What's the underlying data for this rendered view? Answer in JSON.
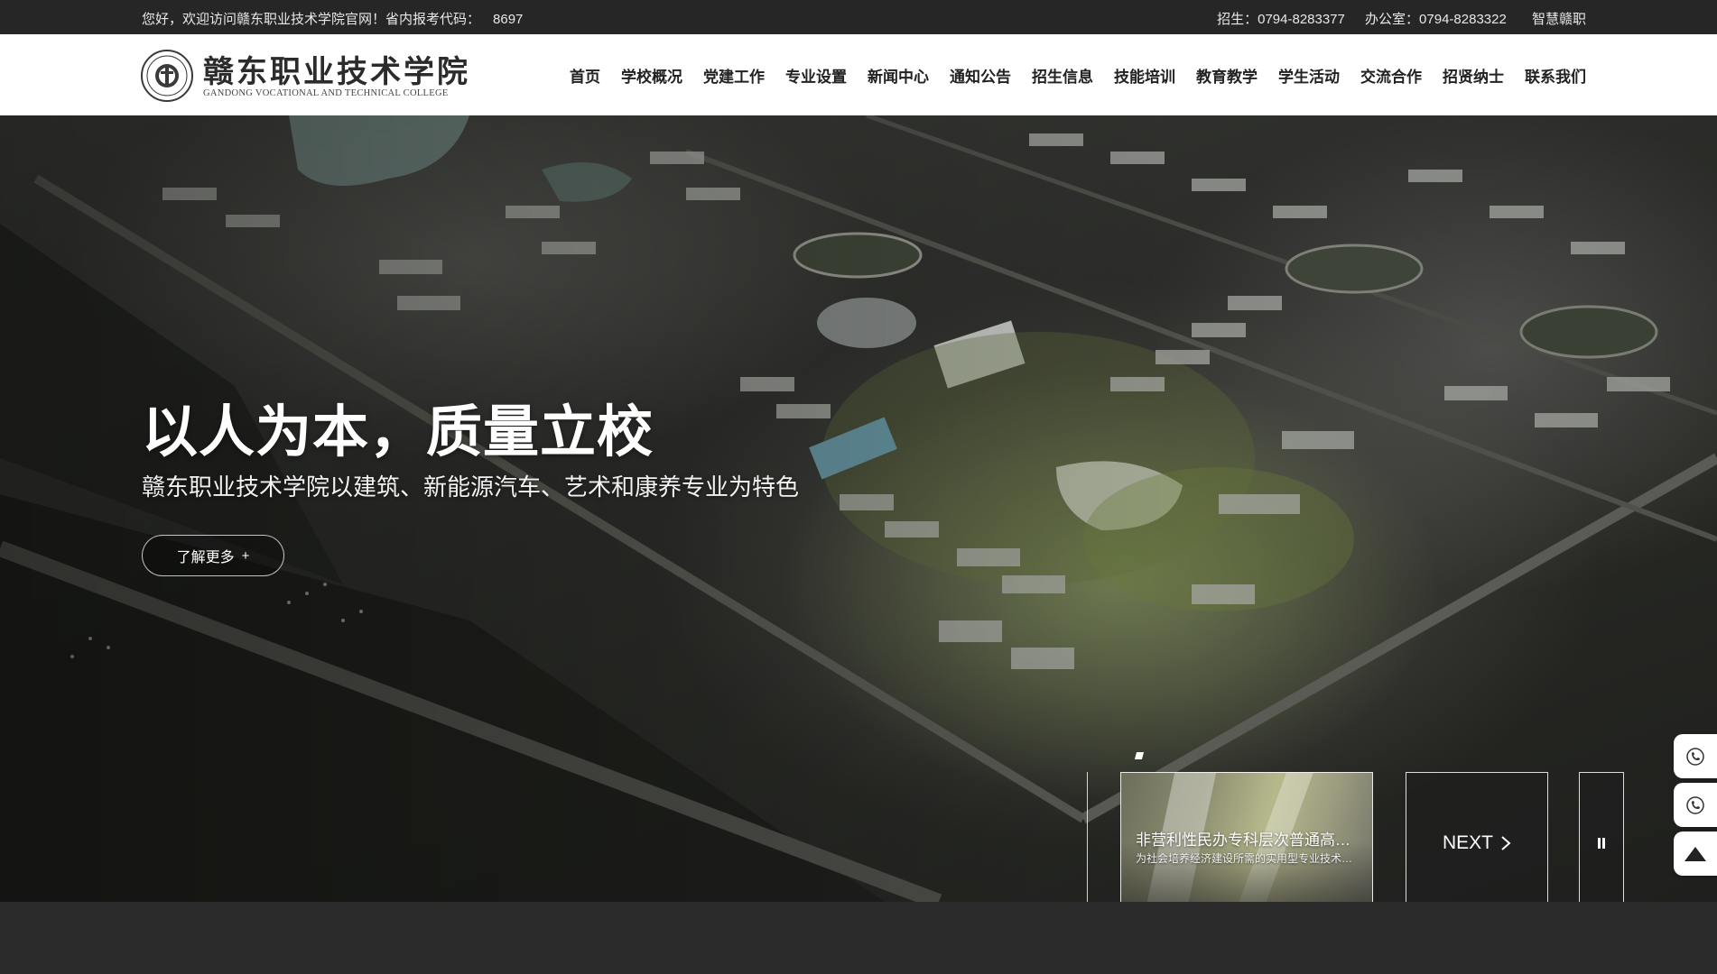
{
  "topbar": {
    "welcome": "您好，欢迎访问赣东职业技术学院官网！省内报考代码：",
    "code": "8697",
    "admissions": "招生：0794-8283377",
    "office": "办公室：0794-8283322",
    "smart": "智慧赣职"
  },
  "logo": {
    "name_cn": "赣东职业技术学院",
    "name_en": "GANDONG VOCATIONAL AND TECHNICAL COLLEGE"
  },
  "nav": {
    "items": [
      {
        "label": "首页"
      },
      {
        "label": "学校概况"
      },
      {
        "label": "党建工作"
      },
      {
        "label": "专业设置"
      },
      {
        "label": "新闻中心"
      },
      {
        "label": "通知公告"
      },
      {
        "label": "招生信息"
      },
      {
        "label": "技能培训"
      },
      {
        "label": "教育教学"
      },
      {
        "label": "学生活动"
      },
      {
        "label": "交流合作"
      },
      {
        "label": "招贤纳士"
      },
      {
        "label": "联系我们"
      }
    ]
  },
  "hero": {
    "title": "以人为本，质量立校",
    "subtitle": "赣东职业技术学院以建筑、新能源汽车、艺术和康养专业为特色",
    "more_label": "了解更多",
    "more_icon": "+"
  },
  "news_card": {
    "title": "非营利性民办专科层次普通高等学校",
    "desc": "为社会培养经济建设所需的实用型专业技术人才"
  },
  "controls": {
    "next_label": "NEXT",
    "next_icon": "chevron-right-icon",
    "pause_icon": "pause-icon"
  },
  "side_tools": [
    {
      "icon": "phone-icon"
    },
    {
      "icon": "phone-icon"
    },
    {
      "icon": "arrow-up-icon"
    }
  ],
  "colors": {
    "topbar_bg": "#262626",
    "header_bg": "#ffffff",
    "nav_text": "#222222",
    "hero_text": "#ffffff"
  }
}
